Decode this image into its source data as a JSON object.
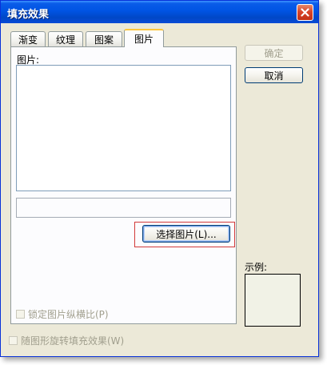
{
  "window": {
    "title": "填充效果"
  },
  "tabs": [
    {
      "label": "渐变",
      "active": false
    },
    {
      "label": "纹理",
      "active": false
    },
    {
      "label": "图案",
      "active": false
    },
    {
      "label": "图片",
      "active": true
    }
  ],
  "picture_panel": {
    "picture_label": "图片:",
    "select_picture_button": "选择图片(L)...",
    "lock_aspect_label": "锁定图片纵横比(P)"
  },
  "rotate_with_shape_label": "随图形旋转填充效果(W)",
  "buttons": {
    "ok": "确定",
    "cancel": "取消"
  },
  "sample": {
    "label": "示例:"
  },
  "colors": {
    "title_bar": "#0054e3",
    "dialog_bg": "#ece9d8",
    "close_button": "#d9452a",
    "highlight_border": "#d23a3a"
  }
}
